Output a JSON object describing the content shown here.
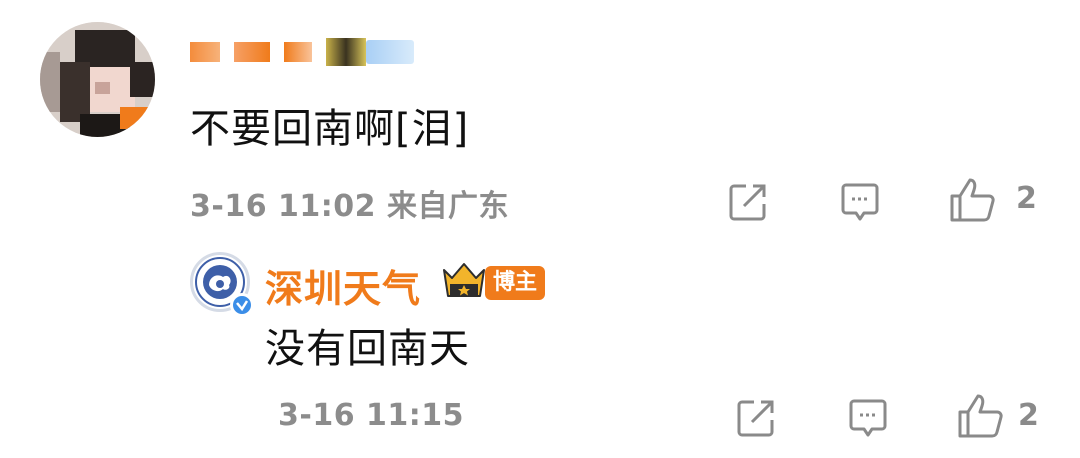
{
  "comment": {
    "author_name": "",
    "text": "不要回南啊[泪]",
    "timestamp": "3-16 11:02",
    "location": "来自广东",
    "like_count": "2"
  },
  "reply": {
    "author_name": "深圳天气",
    "author_badge": "博主",
    "text": "没有回南天",
    "timestamp": "3-16 11:15",
    "like_count": "2"
  },
  "colors": {
    "accent_orange": "#f07b1b",
    "meta_gray": "#8c8c8c",
    "verify_blue": "#3b8ee8"
  },
  "icons": [
    "share-icon",
    "comment-icon",
    "like-icon",
    "crown-icon",
    "verified-icon"
  ]
}
